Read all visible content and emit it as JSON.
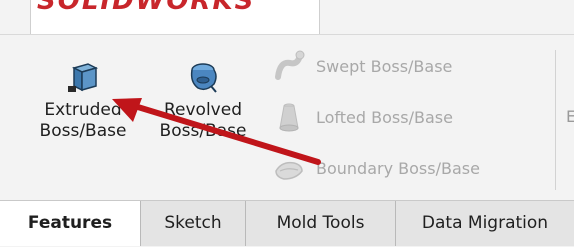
{
  "app": {
    "logo_text": "SOLIDWORKS"
  },
  "ribbon": {
    "big_tools": [
      {
        "line1": "Extruded",
        "line2": "Boss/Base",
        "icon": "extruded-boss-icon"
      },
      {
        "line1": "Revolved",
        "line2": "Boss/Base",
        "icon": "revolved-boss-icon"
      }
    ],
    "small_tools": [
      {
        "label": "Swept Boss/Base",
        "icon": "swept-boss-icon",
        "enabled": false
      },
      {
        "label": "Lofted Boss/Base",
        "icon": "lofted-boss-icon",
        "enabled": false
      },
      {
        "label": "Boundary Boss/Base",
        "icon": "boundary-boss-icon",
        "enabled": false
      }
    ],
    "cut_off_letter": "E"
  },
  "tabs": [
    {
      "label": "Features",
      "active": true
    },
    {
      "label": "Sketch",
      "active": false
    },
    {
      "label": "Mold Tools",
      "active": false
    },
    {
      "label": "Data Migration",
      "active": false
    }
  ],
  "annotation": {
    "arrow_color": "#c0151a"
  }
}
